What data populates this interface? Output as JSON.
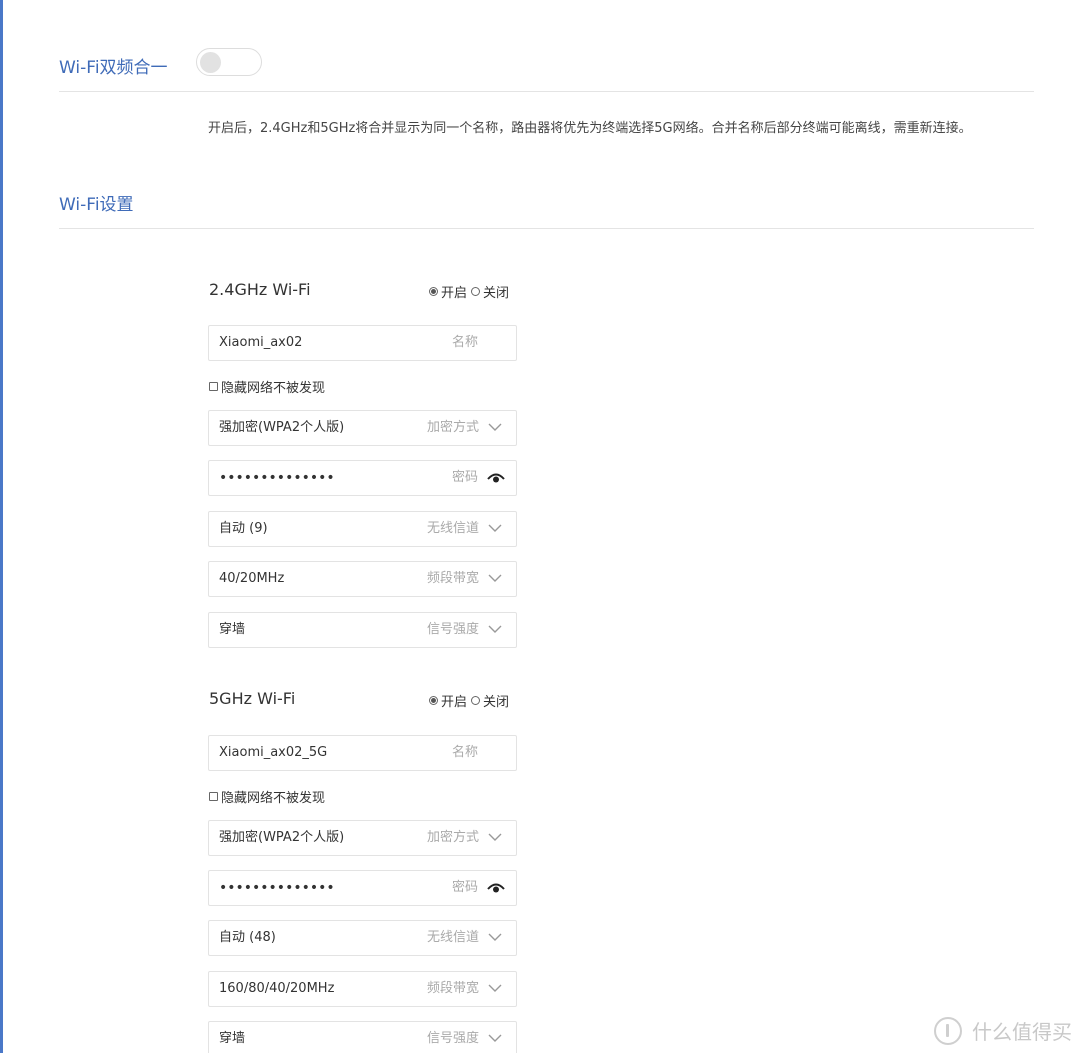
{
  "merge": {
    "title": "Wi-Fi双频合一",
    "enabled": false,
    "description": "开启后，2.4GHz和5GHz将合并显示为同一个名称，路由器将优先为终端选择5G网络。合并名称后部分终端可能离线，需重新连接。"
  },
  "settings": {
    "title": "Wi-Fi设置"
  },
  "bands": [
    {
      "title": "2.4GHz Wi-Fi",
      "on_label": "开启",
      "off_label": "关闭",
      "selected": "on",
      "ssid": {
        "value": "Xiaomi_ax02",
        "label": "名称"
      },
      "hide_label": "隐藏网络不被发现",
      "hidden": false,
      "encryption": {
        "value": "强加密(WPA2个人版)",
        "label": "加密方式"
      },
      "password": {
        "value": "••••••••••••••",
        "label": "密码"
      },
      "channel": {
        "value": "自动 (9)",
        "label": "无线信道"
      },
      "bandwidth": {
        "value": "40/20MHz",
        "label": "频段带宽"
      },
      "signal": {
        "value": "穿墙",
        "label": "信号强度"
      }
    },
    {
      "title": "5GHz Wi-Fi",
      "on_label": "开启",
      "off_label": "关闭",
      "selected": "on",
      "ssid": {
        "value": "Xiaomi_ax02_5G",
        "label": "名称"
      },
      "hide_label": "隐藏网络不被发现",
      "hidden": false,
      "encryption": {
        "value": "强加密(WPA2个人版)",
        "label": "加密方式"
      },
      "password": {
        "value": "••••••••••••••",
        "label": "密码"
      },
      "channel": {
        "value": "自动 (48)",
        "label": "无线信道"
      },
      "bandwidth": {
        "value": "160/80/40/20MHz",
        "label": "频段带宽"
      },
      "signal": {
        "value": "穿墙",
        "label": "信号强度"
      }
    }
  ],
  "watermark": {
    "text": "什么值得买",
    "logo_icon": "zhi-logo-icon"
  },
  "colors": {
    "accent": "#3f6bb8",
    "edge": "#4a78c8",
    "border": "#e3e3e3",
    "placeholder": "#aaaaaa"
  }
}
